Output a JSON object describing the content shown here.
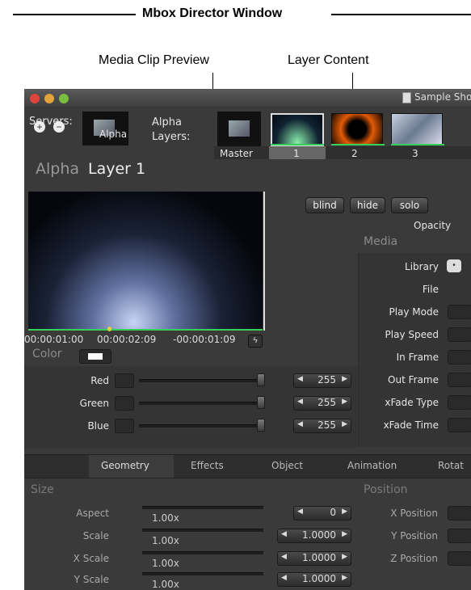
{
  "header": {
    "title": "Mbox Director Window"
  },
  "callouts": {
    "media_preview": "Media Clip Preview",
    "layer_content": "Layer Content"
  },
  "window": {
    "title_doc": "Sample Sho",
    "servers_label": "Servers:",
    "server_name": "Alpha",
    "layers_label_1": "Alpha",
    "layers_label_2": "Layers:",
    "layer_tabs": [
      "Master",
      "1",
      "2",
      "3"
    ],
    "layer_heading_server": "Alpha",
    "layer_heading_layer": "Layer 1",
    "buttons": {
      "blind": "blind",
      "hide": "hide",
      "solo": "solo"
    },
    "opacity_label": "Opacity",
    "media_heading": "Media",
    "timecodes": {
      "start": "00:00:01:00",
      "current": "00:00:02:09",
      "remaining": "-00:00:01:09"
    },
    "color_label": "Color",
    "color_rows": [
      {
        "label": "Red",
        "value": "255"
      },
      {
        "label": "Green",
        "value": "255"
      },
      {
        "label": "Blue",
        "value": "255"
      }
    ],
    "media_fields": [
      "Library",
      "File",
      "Play Mode",
      "Play Speed",
      "In Frame",
      "Out Frame",
      "xFade Type",
      "xFade Time"
    ],
    "tabs": [
      "Geometry",
      "Effects",
      "Object",
      "Animation",
      "Rotat"
    ],
    "size_heading": "Size",
    "position_heading": "Position",
    "size_rows": [
      {
        "label": "Aspect",
        "value": "1.00x",
        "step": "0"
      },
      {
        "label": "Scale",
        "value": "1.00x",
        "step": "1.0000"
      },
      {
        "label": "X Scale",
        "value": "1.00x",
        "step": "1.0000"
      },
      {
        "label": "Y Scale",
        "value": "1.00x",
        "step": "1.0000"
      }
    ],
    "position_rows": [
      "X Position",
      "Y Position",
      "Z Position"
    ]
  },
  "colors": {
    "accent_green": "#34d058",
    "window_bg": "#3a3a3a"
  }
}
